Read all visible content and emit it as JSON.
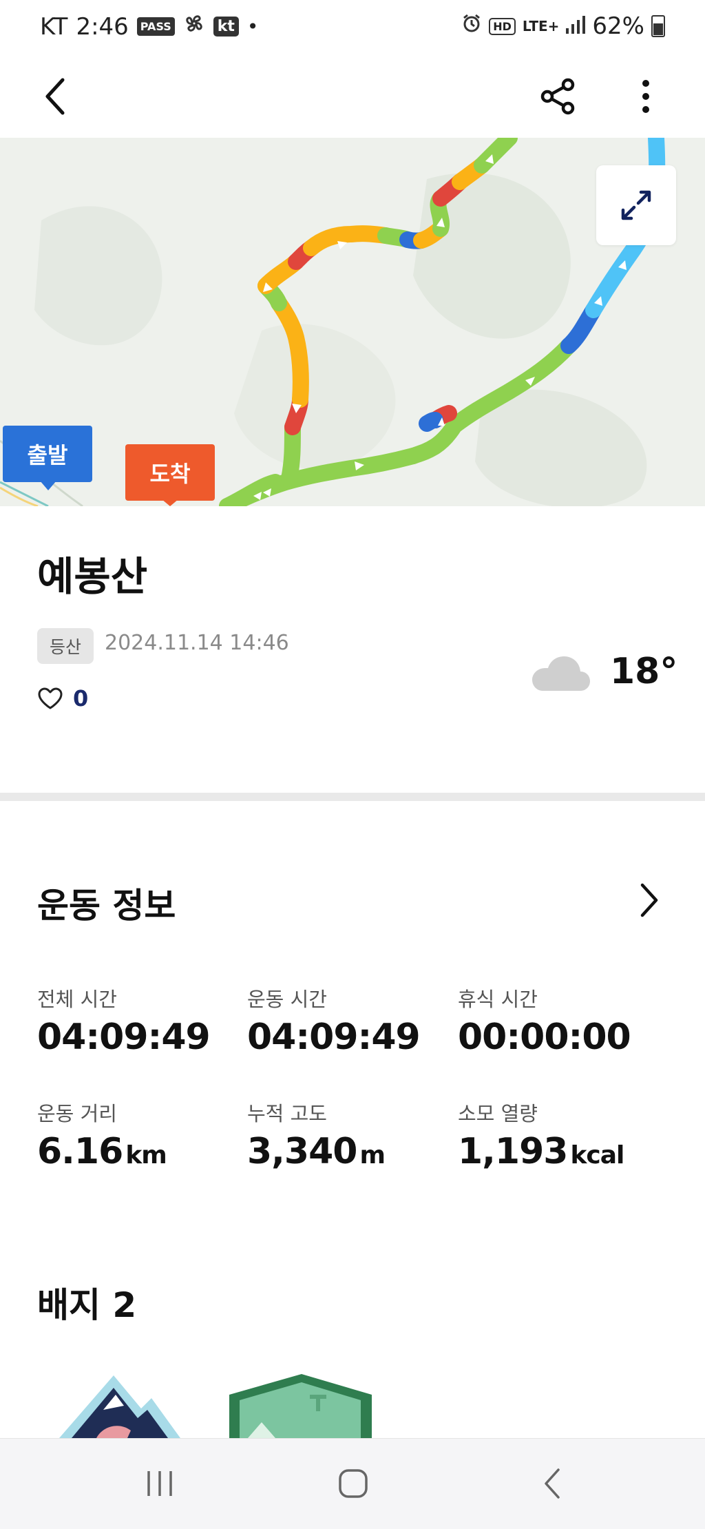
{
  "status_bar": {
    "carrier": "KT",
    "time": "2:46",
    "pass_chip": "PASS",
    "kt_chip": "kt",
    "hd_chip": "HD",
    "network": "LTE+",
    "battery": "62%"
  },
  "map": {
    "start_label": "출발",
    "end_label": "도착"
  },
  "activity": {
    "title": "예봉산",
    "tag": "등산",
    "datetime": "2024.11.14 14:46",
    "like_count": "0",
    "weather_icon": "cloud-icon",
    "temperature": "18°"
  },
  "exercise_info": {
    "section_title": "운동 정보",
    "stats": [
      {
        "label": "전체 시간",
        "value": "04:09:49",
        "unit": ""
      },
      {
        "label": "운동 시간",
        "value": "04:09:49",
        "unit": ""
      },
      {
        "label": "휴식 시간",
        "value": "00:00:00",
        "unit": ""
      },
      {
        "label": "운동 거리",
        "value": "6.16",
        "unit": "km"
      },
      {
        "label": "누적 고도",
        "value": "3,340",
        "unit": "m"
      },
      {
        "label": "소모 열량",
        "value": "1,193",
        "unit": "kcal"
      }
    ]
  },
  "badges": {
    "title": "배지 2"
  },
  "colors": {
    "route_green": "#8fd14f",
    "route_orange": "#fbb216",
    "route_red": "#e0463c",
    "route_blue": "#2d6fd6",
    "route_cyan": "#4fc3f7",
    "start_marker": "#2a72d8",
    "end_marker": "#ee5a2c",
    "like_count": "#1a2a6c"
  }
}
